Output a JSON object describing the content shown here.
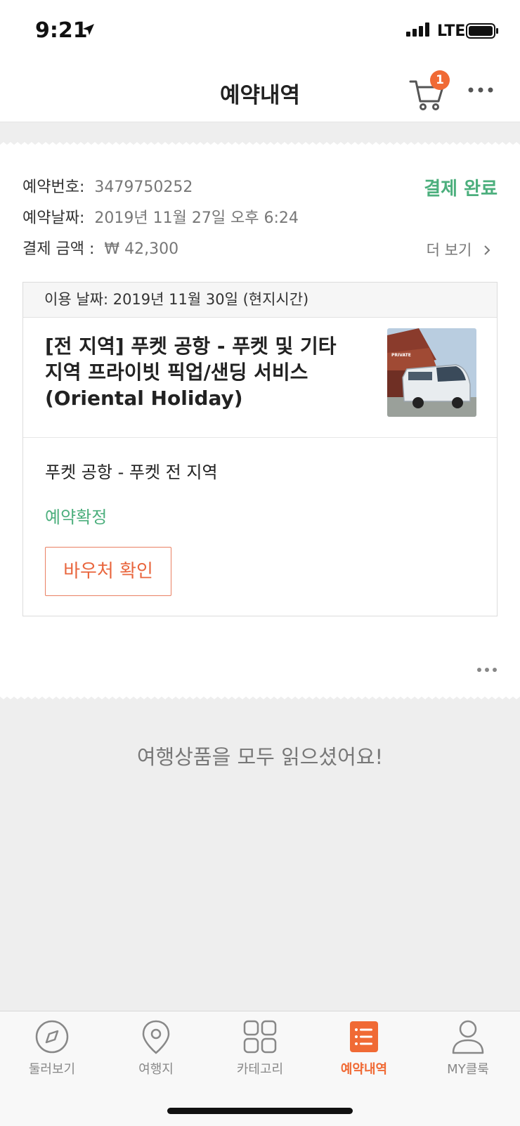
{
  "status_bar": {
    "time": "9:21",
    "network": "LTE"
  },
  "header": {
    "title": "예약내역",
    "cart_count": "1"
  },
  "order": {
    "number_label": "예약번호:",
    "number_value": "3479750252",
    "date_label": "예약날짜:",
    "date_value": "2019년 11월 27일 오후 6:24",
    "amount_label": "결제 금액 :",
    "amount_value": "₩ 42,300",
    "payment_status": "결제 완료",
    "more_label": "더 보기",
    "item": {
      "use_date": "이용 날짜: 2019년 11월 30일 (현지시간)",
      "title": "[전 지역] 푸켓 공항 - 푸켓 및 기타 지역 프라이빗 픽업/샌딩 서비스 (Oriental Holiday)",
      "thumb_text": "PRIVATE",
      "route": "푸켓 공항 - 푸켓 전 지역",
      "status": "예약확정",
      "voucher_label": "바우처 확인"
    }
  },
  "end_message": "여행상품을 모두 읽으셨어요!",
  "tabs": [
    {
      "label": "둘러보기",
      "icon": "compass-icon"
    },
    {
      "label": "여행지",
      "icon": "location-pin-icon"
    },
    {
      "label": "카테고리",
      "icon": "category-grid-icon"
    },
    {
      "label": "예약내역",
      "icon": "reservation-list-icon",
      "active": true
    },
    {
      "label": "MY클룩",
      "icon": "user-icon"
    }
  ],
  "colors": {
    "accent": "#f06a35",
    "success": "#4caf7d"
  }
}
